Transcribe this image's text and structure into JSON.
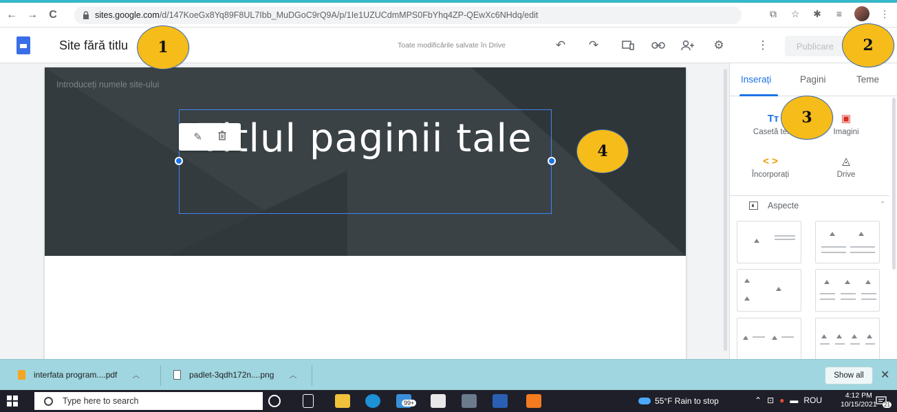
{
  "browser": {
    "url_host": "sites.google.com",
    "url_path": "/d/147KoeGx8Yq89F8UL7Ibb_MuDGoC9rQ9A/p/1Ie1UZUCdmMPS0FbYhq4ZP-QEwXc6NHdq/edit"
  },
  "app": {
    "site_title": "Site fără titlu",
    "save_status": "Toate modificările salvate în Drive",
    "publish_label": "Publicare"
  },
  "page": {
    "site_name_placeholder": "Introduceți numele site-ului",
    "page_title": "Titlul paginii tale"
  },
  "panel": {
    "tabs": [
      "Inserați",
      "Pagini",
      "Teme"
    ],
    "insert_items": [
      {
        "label": "Casetă text",
        "icon": "text-box-icon",
        "glyph": "Tт"
      },
      {
        "label": "Imagini",
        "icon": "image-icon",
        "glyph": "▣"
      },
      {
        "label": "Încorporați",
        "icon": "embed-icon",
        "glyph": "< >"
      },
      {
        "label": "Drive",
        "icon": "drive-icon",
        "glyph": "◬"
      }
    ],
    "layouts_label": "Aspecte"
  },
  "downloads": {
    "items": [
      "interfata program....pdf",
      "padlet-3qdh172n....png"
    ],
    "show_all": "Show all"
  },
  "taskbar": {
    "search_placeholder": "Type here to search",
    "mail_badge": "99+",
    "weather": "55°F  Rain to stop",
    "language": "ROU",
    "time": "4:12 PM",
    "date": "10/15/2021",
    "notifications": "21"
  },
  "callouts": [
    "1",
    "2",
    "3",
    "4"
  ],
  "colors": {
    "accent": "#1a73e8",
    "callout": "#f6bc1a",
    "hero": "#3a4246",
    "downloads_bar": "#9fd6df"
  }
}
